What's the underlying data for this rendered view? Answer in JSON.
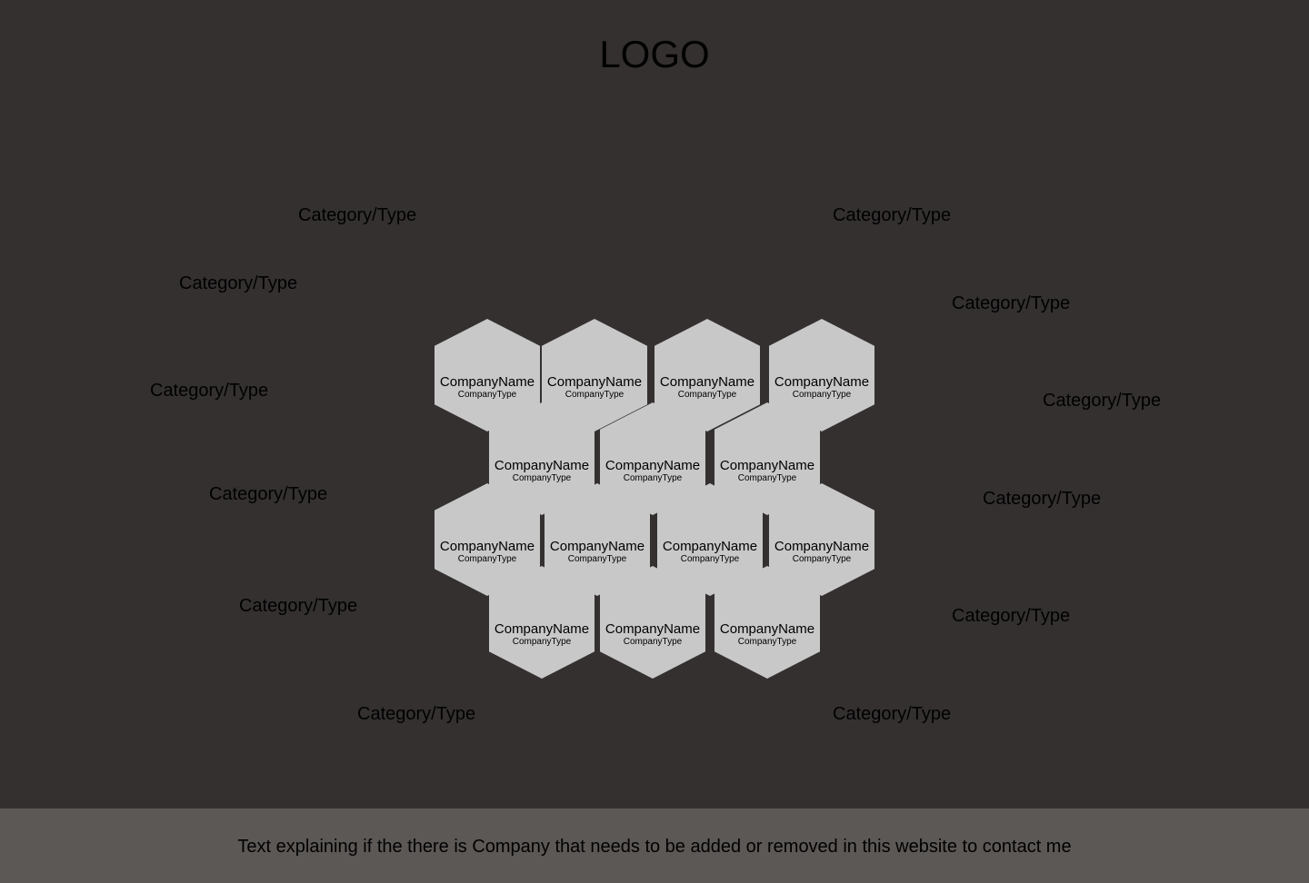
{
  "header": {
    "logo_text": "LOGO"
  },
  "categories": [
    {
      "label": "Category/Type"
    },
    {
      "label": "Category/Type"
    },
    {
      "label": "Category/Type"
    },
    {
      "label": "Category/Type"
    },
    {
      "label": "Category/Type"
    },
    {
      "label": "Category/Type"
    },
    {
      "label": "Category/Type"
    },
    {
      "label": "Category/Type"
    },
    {
      "label": "Category/Type"
    },
    {
      "label": "Category/Type"
    },
    {
      "label": "Category/Type"
    },
    {
      "label": "Category/Type"
    }
  ],
  "companies": [
    {
      "name": "CompanyName",
      "type": "CompanyType"
    },
    {
      "name": "CompanyName",
      "type": "CompanyType"
    },
    {
      "name": "CompanyName",
      "type": "CompanyType"
    },
    {
      "name": "CompanyName",
      "type": "CompanyType"
    },
    {
      "name": "CompanyName",
      "type": "CompanyType"
    },
    {
      "name": "CompanyName",
      "type": "CompanyType"
    },
    {
      "name": "CompanyName",
      "type": "CompanyType"
    },
    {
      "name": "CompanyName",
      "type": "CompanyType"
    },
    {
      "name": "CompanyName",
      "type": "CompanyType"
    },
    {
      "name": "CompanyName",
      "type": "CompanyType"
    },
    {
      "name": "CompanyName",
      "type": "CompanyType"
    },
    {
      "name": "CompanyName",
      "type": "CompanyType"
    },
    {
      "name": "CompanyName",
      "type": "CompanyType"
    },
    {
      "name": "CompanyName",
      "type": "CompanyType"
    }
  ],
  "footer": {
    "text": "Text explaining if the there is Company that needs to be added or removed in this website to contact me"
  },
  "colors": {
    "background": "#343030",
    "hexagon": "#c8c8c8",
    "footer": "#5c5856"
  }
}
